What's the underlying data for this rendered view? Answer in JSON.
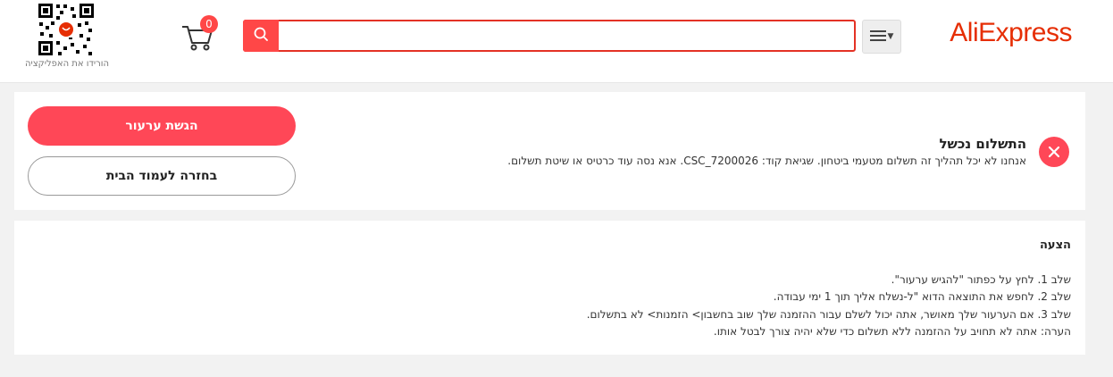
{
  "header": {
    "logo_text": "AliExpress",
    "brand_color": "#e62e04",
    "accent_color": "#ff4747",
    "categories_icon": "hamburger-menu-icon",
    "search": {
      "value": "",
      "placeholder": "",
      "icon": "search-icon"
    },
    "cart": {
      "count": "0",
      "icon": "shopping-cart-icon"
    },
    "app_download": {
      "caption": "הורידו את האפליקציה",
      "icon": "qr-code-icon"
    }
  },
  "status": {
    "icon": "close-circle-icon",
    "title": "התשלום נכשל",
    "message": "אנחנו לא יכל תהליך זה תשלום מטעמי ביטחון. שגיאת קוד: CSC_7200026. אנא נסה עוד כרטיס או שיטת תשלום."
  },
  "actions": {
    "submit_appeal": "הגשת ערעור",
    "back_home": "בחזרה לעמוד הבית"
  },
  "suggestion": {
    "title": "הצעה",
    "steps": [
      "שלב 1. לחץ על כפתור \"להגיש ערעור\".",
      "שלב 2. לחפש את התוצאה הדוא \"ל-נשלח אליך תוך 1 ימי עבודה.",
      "שלב 3. אם הערעור שלך מאושר, אתה יכול לשלם עבור ההזמנה שלך שוב בחשבון> הזמנות> לא בתשלום.",
      "הערה: אתה לא תחויב על ההזמנה ללא תשלום כדי שלא יהיה צורך לבטל אותו."
    ]
  }
}
